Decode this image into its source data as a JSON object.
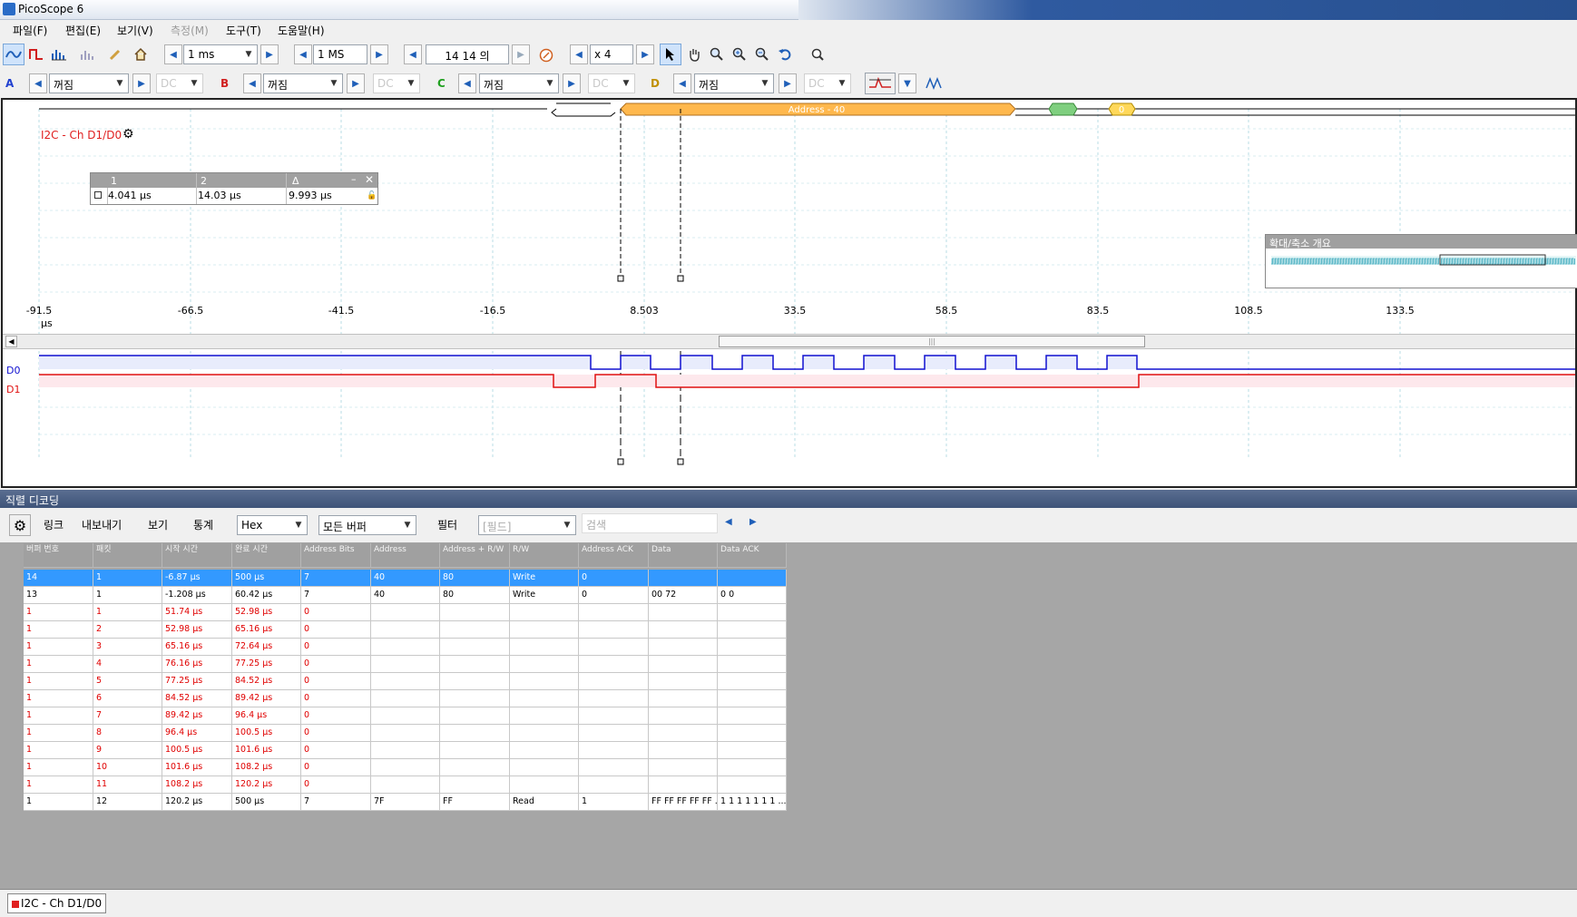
{
  "window": {
    "title": "PicoScope 6"
  },
  "menu": [
    {
      "label": "파일(F)",
      "enabled": true
    },
    {
      "label": "편집(E)",
      "enabled": true
    },
    {
      "label": "보기(V)",
      "enabled": true
    },
    {
      "label": "측정(M)",
      "enabled": false
    },
    {
      "label": "도구(T)",
      "enabled": true
    },
    {
      "label": "도움말(H)",
      "enabled": true
    }
  ],
  "toolbar1": {
    "timebase": "1 ms",
    "samples": "1 MS",
    "buffer": "14 14 의",
    "zoom_factor": "x 4"
  },
  "channels": [
    {
      "name": "A",
      "range": "꺼짐",
      "coupling": "DC",
      "color": "#2040d0"
    },
    {
      "name": "B",
      "range": "꺼짐",
      "coupling": "DC",
      "color": "#d02020"
    },
    {
      "name": "C",
      "range": "꺼짐",
      "coupling": "DC",
      "color": "#20a020"
    },
    {
      "name": "D",
      "range": "꺼짐",
      "coupling": "DC",
      "color": "#c09000"
    }
  ],
  "scope": {
    "decoder_label": "I2C - Ch D1/D0",
    "address_packet": "Address - 40",
    "data_packet": "0",
    "x_ticks": [
      "-91.5",
      "-66.5",
      "-41.5",
      "-16.5",
      "8.503",
      "33.5",
      "58.5",
      "83.5",
      "108.5",
      "133.5"
    ],
    "x_unit": "µs",
    "digital_channels": [
      "D0",
      "D1"
    ],
    "colors": {
      "d0": "#1010d0",
      "d1": "#e01010",
      "address": "#ffb84d",
      "ack": "#7fcf7f",
      "data": "#ffd85a"
    }
  },
  "cursor_table": {
    "headers": [
      "1",
      "2",
      "Δ"
    ],
    "values": [
      "4.041 µs",
      "14.03 µs",
      "9.993 µs"
    ]
  },
  "zoom_overview": {
    "title": "확대/축소 개요"
  },
  "decoder": {
    "title": "직렬 디코딩",
    "toolbar": {
      "link": "링크",
      "export": "내보내기",
      "view": "보기",
      "stats": "통계",
      "format": "Hex",
      "buffer": "모든 버퍼",
      "filter": "필터",
      "field_placeholder": "[필드]",
      "search_placeholder": "검색"
    },
    "columns": [
      "버퍼 번호",
      "패킷",
      "시작 시간",
      "완료 시간",
      "Address Bits",
      "Address",
      "Address + R/W",
      "R/W",
      "Address ACK",
      "Data",
      "Data ACK"
    ],
    "rows": [
      {
        "state": "sel",
        "cells": [
          "14",
          "1",
          "-6.87 µs",
          "500 µs",
          "7",
          "40",
          "80",
          "Write",
          "0",
          "",
          ""
        ]
      },
      {
        "state": "ok",
        "cells": [
          "13",
          "1",
          "-1.208 µs",
          "60.42 µs",
          "7",
          "40",
          "80",
          "Write",
          "0",
          "00 72",
          "0 0"
        ]
      },
      {
        "state": "err",
        "cells": [
          "1",
          "1",
          "51.74 µs",
          "52.98 µs",
          "0",
          "",
          "",
          "",
          "",
          "",
          ""
        ]
      },
      {
        "state": "err",
        "cells": [
          "1",
          "2",
          "52.98 µs",
          "65.16 µs",
          "0",
          "",
          "",
          "",
          "",
          "",
          ""
        ]
      },
      {
        "state": "err",
        "cells": [
          "1",
          "3",
          "65.16 µs",
          "72.64 µs",
          "0",
          "",
          "",
          "",
          "",
          "",
          ""
        ]
      },
      {
        "state": "err",
        "cells": [
          "1",
          "4",
          "76.16 µs",
          "77.25 µs",
          "0",
          "",
          "",
          "",
          "",
          "",
          ""
        ]
      },
      {
        "state": "err",
        "cells": [
          "1",
          "5",
          "77.25 µs",
          "84.52 µs",
          "0",
          "",
          "",
          "",
          "",
          "",
          ""
        ]
      },
      {
        "state": "err",
        "cells": [
          "1",
          "6",
          "84.52 µs",
          "89.42 µs",
          "0",
          "",
          "",
          "",
          "",
          "",
          ""
        ]
      },
      {
        "state": "err",
        "cells": [
          "1",
          "7",
          "89.42 µs",
          "96.4 µs",
          "0",
          "",
          "",
          "",
          "",
          "",
          ""
        ]
      },
      {
        "state": "err",
        "cells": [
          "1",
          "8",
          "96.4 µs",
          "100.5 µs",
          "0",
          "",
          "",
          "",
          "",
          "",
          ""
        ]
      },
      {
        "state": "err",
        "cells": [
          "1",
          "9",
          "100.5 µs",
          "101.6 µs",
          "0",
          "",
          "",
          "",
          "",
          "",
          ""
        ]
      },
      {
        "state": "err",
        "cells": [
          "1",
          "10",
          "101.6 µs",
          "108.2 µs",
          "0",
          "",
          "",
          "",
          "",
          "",
          ""
        ]
      },
      {
        "state": "err",
        "cells": [
          "1",
          "11",
          "108.2 µs",
          "120.2 µs",
          "0",
          "",
          "",
          "",
          "",
          "",
          ""
        ]
      },
      {
        "state": "ok",
        "cells": [
          "1",
          "12",
          "120.2 µs",
          "500 µs",
          "7",
          "7F",
          "FF",
          "Read",
          "1",
          "FF FF FF FF FF ...",
          "1 1 1 1 1 1 1 ..."
        ]
      }
    ]
  },
  "status_tab": "I2C - Ch D1/D0"
}
